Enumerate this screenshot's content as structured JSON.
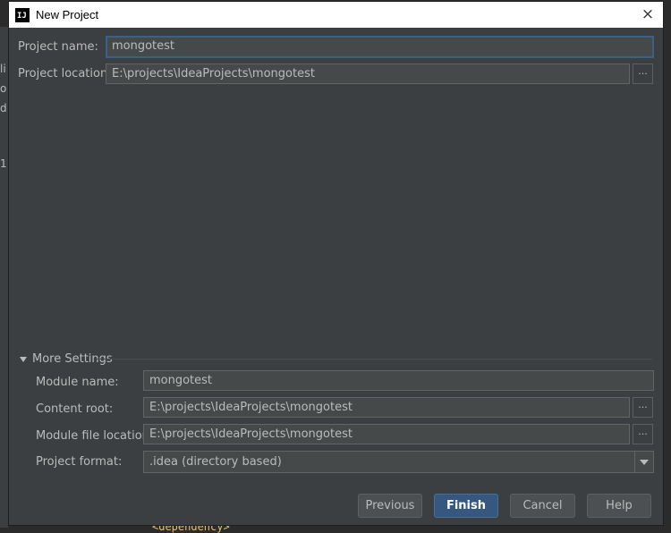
{
  "background": {
    "left_fragments": [
      "li",
      "o",
      "d",
      "1"
    ],
    "bottom_code": "<dependency>"
  },
  "window": {
    "title": "New Project",
    "app_icon": "IJ",
    "close_icon": "×"
  },
  "form": {
    "project_name_label": "Project name:",
    "project_name_value": "mongotest",
    "project_location_label": "Project location:",
    "project_location_value": "E:\\projects\\IdeaProjects\\mongotest",
    "browse_label": "..."
  },
  "more_settings": {
    "header": "More Settings",
    "module_name_label": "Module name:",
    "module_name_value": "mongotest",
    "content_root_label": "Content root:",
    "content_root_value": "E:\\projects\\IdeaProjects\\mongotest",
    "module_file_location_label": "Module file location:",
    "module_file_location_value": "E:\\projects\\IdeaProjects\\mongotest",
    "project_format_label": "Project format:",
    "project_format_value": ".idea (directory based)"
  },
  "buttons": {
    "previous": "Previous",
    "finish": "Finish",
    "cancel": "Cancel",
    "help": "Help"
  }
}
